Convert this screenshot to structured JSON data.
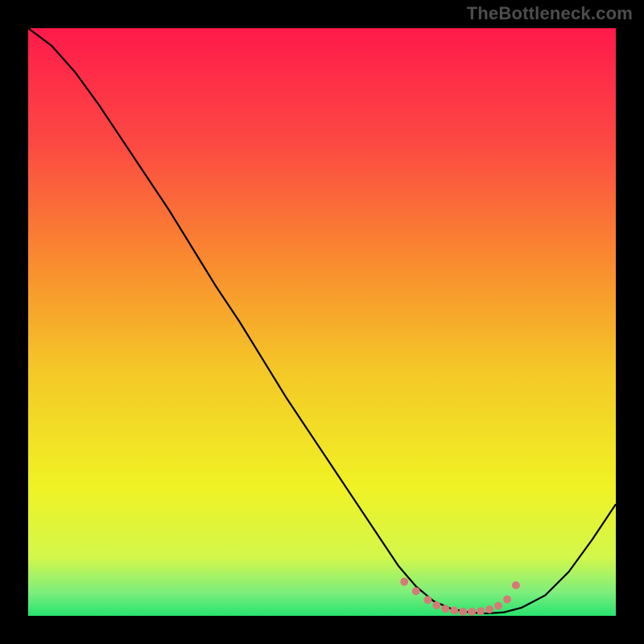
{
  "watermark": "TheBottleneck.com",
  "chart_data": {
    "type": "line",
    "title": "",
    "xlabel": "",
    "ylabel": "",
    "xlim": [
      0,
      100
    ],
    "ylim": [
      0,
      100
    ],
    "gradient": {
      "type": "vertical-rainbow",
      "stops": [
        {
          "offset": 0.0,
          "color": "#ff1a4b"
        },
        {
          "offset": 0.2,
          "color": "#fc4a42"
        },
        {
          "offset": 0.4,
          "color": "#f98c2f"
        },
        {
          "offset": 0.58,
          "color": "#f4c727"
        },
        {
          "offset": 0.78,
          "color": "#f0f224"
        },
        {
          "offset": 0.9,
          "color": "#d3f74a"
        },
        {
          "offset": 0.96,
          "color": "#7eee7c"
        },
        {
          "offset": 1.0,
          "color": "#27e36e"
        }
      ]
    },
    "series": [
      {
        "name": "curve",
        "type": "line",
        "color": "#000000",
        "x": [
          0,
          4,
          8,
          12,
          16,
          20,
          24,
          28,
          32,
          36,
          40,
          44,
          48,
          52,
          56,
          60,
          63,
          66,
          69,
          72,
          75,
          78,
          81,
          84,
          88,
          92,
          96,
          100
        ],
        "y": [
          100,
          97,
          92.5,
          87,
          81,
          75,
          69,
          62.5,
          56,
          50,
          43.5,
          37,
          31,
          25,
          19,
          13,
          8.5,
          5,
          2.5,
          1.2,
          0.6,
          0.4,
          0.6,
          1.4,
          3.5,
          7.5,
          13,
          19
        ]
      },
      {
        "name": "optimal-band-dots",
        "type": "scatter",
        "color": "#d47a77",
        "x": [
          64,
          66,
          68,
          69.5,
          71,
          72.5,
          74,
          75.5,
          77,
          78.5,
          80,
          81.5,
          83
        ],
        "y": [
          5.8,
          4.2,
          2.7,
          1.8,
          1.2,
          0.9,
          0.7,
          0.7,
          0.8,
          1.1,
          1.7,
          2.8,
          5.2
        ]
      }
    ]
  }
}
